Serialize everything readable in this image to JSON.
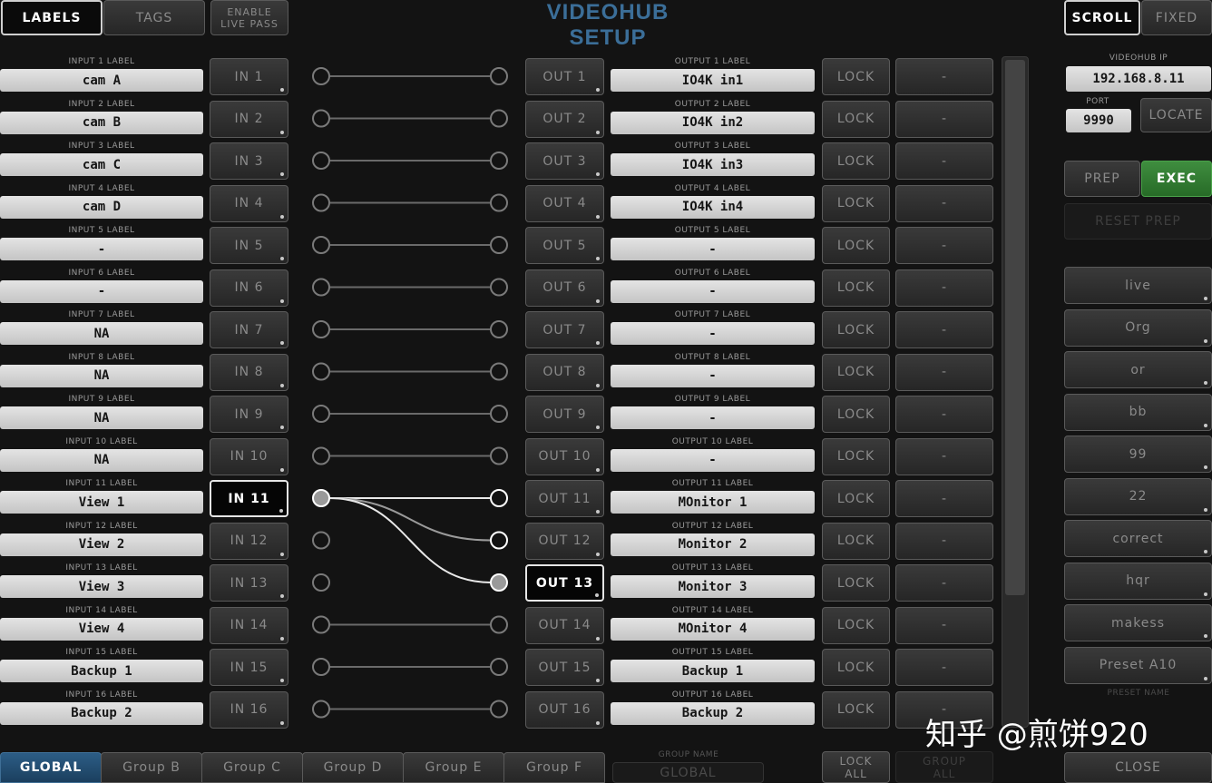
{
  "title": "VIDEOHUB SETUP",
  "top_tabs": [
    {
      "label": "LABELS",
      "active": true
    },
    {
      "label": "TAGS",
      "active": false
    }
  ],
  "live_pass": {
    "line1": "ENABLE",
    "line2": "LIVE PASS"
  },
  "view_tabs": [
    {
      "label": "SCROLL",
      "active": true
    },
    {
      "label": "FIXED",
      "active": false
    }
  ],
  "videohub_ip": {
    "label": "VIDEOHUB IP",
    "value": "192.168.8.11"
  },
  "port": {
    "label": "PORT",
    "value": "9990"
  },
  "locate_label": "LOCATE",
  "prep_label": "PREP",
  "exec_label": "EXEC",
  "reset_prep_label": "RESET PREP",
  "preset_name_label": "PRESET NAME",
  "presets": [
    "live",
    "Org",
    "or",
    "bb",
    "99",
    "22",
    "correct",
    "hqr",
    "makess",
    "Preset A10"
  ],
  "inputs": [
    {
      "label_caption": "INPUT 1 LABEL",
      "label": "cam A",
      "button": "IN 1"
    },
    {
      "label_caption": "INPUT 2 LABEL",
      "label": "cam B",
      "button": "IN 2"
    },
    {
      "label_caption": "INPUT 3 LABEL",
      "label": "cam C",
      "button": "IN 3"
    },
    {
      "label_caption": "INPUT 4 LABEL",
      "label": "cam D",
      "button": "IN 4"
    },
    {
      "label_caption": "INPUT 5 LABEL",
      "label": "-",
      "button": "IN 5"
    },
    {
      "label_caption": "INPUT 6 LABEL",
      "label": "-",
      "button": "IN 6"
    },
    {
      "label_caption": "INPUT 7 LABEL",
      "label": "NA",
      "button": "IN 7"
    },
    {
      "label_caption": "INPUT 8 LABEL",
      "label": "NA",
      "button": "IN 8"
    },
    {
      "label_caption": "INPUT 9 LABEL",
      "label": "NA",
      "button": "IN 9"
    },
    {
      "label_caption": "INPUT 10 LABEL",
      "label": "NA",
      "button": "IN 10"
    },
    {
      "label_caption": "INPUT 11 LABEL",
      "label": "View 1",
      "button": "IN 11"
    },
    {
      "label_caption": "INPUT 12 LABEL",
      "label": "View 2",
      "button": "IN 12"
    },
    {
      "label_caption": "INPUT 13 LABEL",
      "label": "View 3",
      "button": "IN 13"
    },
    {
      "label_caption": "INPUT 14 LABEL",
      "label": "View 4",
      "button": "IN 14"
    },
    {
      "label_caption": "INPUT 15 LABEL",
      "label": "Backup 1",
      "button": "IN 15"
    },
    {
      "label_caption": "INPUT 16 LABEL",
      "label": "Backup 2",
      "button": "IN 16"
    }
  ],
  "outputs": [
    {
      "label_caption": "OUTPUT 1 LABEL",
      "label": "IO4K in1",
      "button": "OUT 1"
    },
    {
      "label_caption": "OUTPUT 2 LABEL",
      "label": "IO4K in2",
      "button": "OUT 2"
    },
    {
      "label_caption": "OUTPUT 3 LABEL",
      "label": "IO4K in3",
      "button": "OUT 3"
    },
    {
      "label_caption": "OUTPUT 4 LABEL",
      "label": "IO4K in4",
      "button": "OUT 4"
    },
    {
      "label_caption": "OUTPUT 5 LABEL",
      "label": "-",
      "button": "OUT 5"
    },
    {
      "label_caption": "OUTPUT 6 LABEL",
      "label": "-",
      "button": "OUT 6"
    },
    {
      "label_caption": "OUTPUT 7 LABEL",
      "label": "-",
      "button": "OUT 7"
    },
    {
      "label_caption": "OUTPUT 8 LABEL",
      "label": "-",
      "button": "OUT 8"
    },
    {
      "label_caption": "OUTPUT 9 LABEL",
      "label": "-",
      "button": "OUT 9"
    },
    {
      "label_caption": "OUTPUT 10 LABEL",
      "label": "-",
      "button": "OUT 10"
    },
    {
      "label_caption": "OUTPUT 11 LABEL",
      "label": "MOnitor 1",
      "button": "OUT 11"
    },
    {
      "label_caption": "OUTPUT 12 LABEL",
      "label": "Monitor 2",
      "button": "OUT 12"
    },
    {
      "label_caption": "OUTPUT 13 LABEL",
      "label": "Monitor 3",
      "button": "OUT 13"
    },
    {
      "label_caption": "OUTPUT 14 LABEL",
      "label": "MOnitor 4",
      "button": "OUT 14"
    },
    {
      "label_caption": "OUTPUT 15 LABEL",
      "label": "Backup 1",
      "button": "OUT 15"
    },
    {
      "label_caption": "OUTPUT 16 LABEL",
      "label": "Backup 2",
      "button": "OUT 16"
    }
  ],
  "lock_label": "LOCK",
  "tag_placeholder": "-",
  "active_input": "IN 11",
  "active_output": "OUT 13",
  "routes": [
    {
      "input": 11,
      "output": 11
    },
    {
      "input": 11,
      "output": 12
    },
    {
      "input": 11,
      "output": 13
    }
  ],
  "groups": [
    {
      "label": "GLOBAL",
      "active": true
    },
    {
      "label": "Group B",
      "active": false
    },
    {
      "label": "Group C",
      "active": false
    },
    {
      "label": "Group D",
      "active": false
    },
    {
      "label": "Group E",
      "active": false
    },
    {
      "label": "Group F",
      "active": false
    }
  ],
  "group_name": {
    "label": "GROUP NAME",
    "value": "GLOBAL"
  },
  "lock_all": {
    "line1": "LOCK",
    "line2": "ALL"
  },
  "group_all": {
    "line1": "GROUP",
    "line2": "ALL"
  },
  "close_label": "CLOSE",
  "watermark": "知乎 @煎饼920"
}
